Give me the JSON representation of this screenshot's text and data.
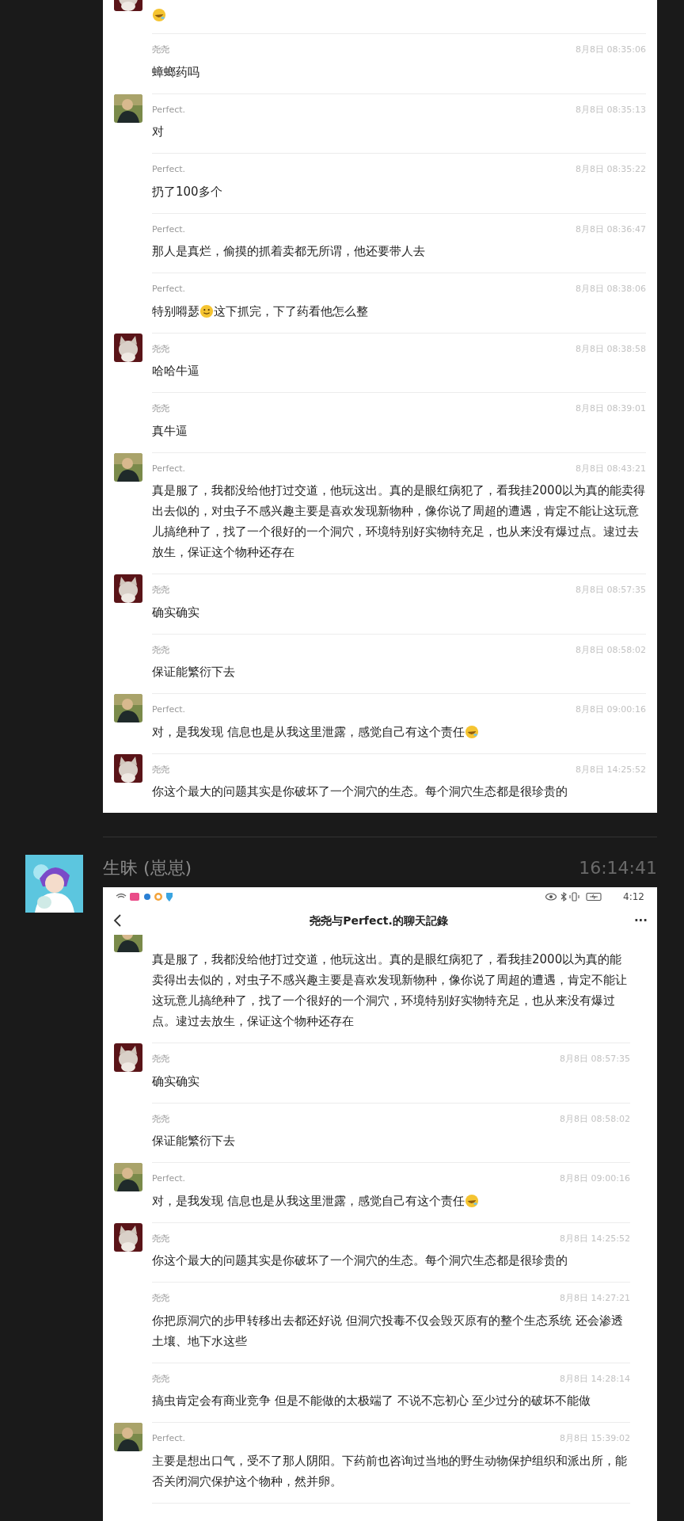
{
  "top_card": {
    "messages": [
      {
        "avatar": {
          "kind": "cat"
        },
        "cut": true,
        "parts": [
          {
            "kind": "laugh_emoji"
          }
        ]
      },
      {
        "name": "尧尧",
        "time": "8月8日 08:35:06",
        "parts": [
          {
            "kind": "text",
            "text": "蟑螂药吗"
          }
        ]
      },
      {
        "avatar": {
          "kind": "person"
        },
        "name": "Perfect.",
        "time": "8月8日 08:35:13",
        "parts": [
          {
            "kind": "text",
            "text": "对"
          }
        ]
      },
      {
        "name": "Perfect.",
        "time": "8月8日 08:35:22",
        "parts": [
          {
            "kind": "text",
            "text": "扔了100多个"
          }
        ]
      },
      {
        "name": "Perfect.",
        "time": "8月8日 08:36:47",
        "parts": [
          {
            "kind": "text",
            "text": "那人是真烂，偷摸的抓着卖都无所谓，他还要带人去"
          }
        ]
      },
      {
        "name": "Perfect.",
        "time": "8月8日 08:38:06",
        "parts": [
          {
            "kind": "text",
            "text": "特别嘚瑟"
          },
          {
            "kind": "smile_emoji"
          },
          {
            "kind": "text",
            "text": "这下抓完，下了药看他怎么整"
          }
        ]
      },
      {
        "avatar": {
          "kind": "cat"
        },
        "name": "尧尧",
        "time": "8月8日 08:38:58",
        "parts": [
          {
            "kind": "text",
            "text": "哈哈牛逼"
          }
        ]
      },
      {
        "name": "尧尧",
        "time": "8月8日 08:39:01",
        "parts": [
          {
            "kind": "text",
            "text": "真牛逼"
          }
        ]
      },
      {
        "avatar": {
          "kind": "person"
        },
        "name": "Perfect.",
        "time": "8月8日 08:43:21",
        "parts": [
          {
            "kind": "text",
            "text": "真是服了，我都没给他打过交道，他玩这出。真的是眼红病犯了，看我挂2000以为真的能卖得出去似的，对虫子不感兴趣主要是喜欢发现新物种，像你说了周超的遭遇，肯定不能让这玩意儿搞绝种了，找了一个很好的一个洞穴，环境特别好实物特充足，也从来没有爆过点。逮过去放生，保证这个物种还存在"
          }
        ]
      },
      {
        "avatar": {
          "kind": "cat"
        },
        "name": "尧尧",
        "time": "8月8日 08:57:35",
        "parts": [
          {
            "kind": "text",
            "text": "确实确实"
          }
        ]
      },
      {
        "name": "尧尧",
        "time": "8月8日 08:58:02",
        "parts": [
          {
            "kind": "text",
            "text": "保证能繁衍下去"
          }
        ]
      },
      {
        "avatar": {
          "kind": "person"
        },
        "name": "Perfect.",
        "time": "8月8日 09:00:16",
        "parts": [
          {
            "kind": "text",
            "text": "对，是我发现 信息也是从我这里泄露，感觉自己有这个责任"
          },
          {
            "kind": "laugh_emoji"
          }
        ]
      },
      {
        "avatar": {
          "kind": "cat"
        },
        "name": "尧尧",
        "time": "8月8日 14:25:52",
        "parts": [
          {
            "kind": "text",
            "text": "你这个最大的问题其实是你破坏了一个洞穴的生态。每个洞穴生态都是很珍贵的"
          }
        ]
      }
    ]
  },
  "post": {
    "sender": "生昧 (崽崽)",
    "time": "16:14:41"
  },
  "screenshot": {
    "status_time": "4:12",
    "title": "尧尧与Perfect.的聊天記錄",
    "more": "···",
    "messages": [
      {
        "avatar": {
          "kind": "person"
        },
        "cut": true,
        "parts": [
          {
            "kind": "text",
            "text": "真是服了，我都没给他打过交道，他玩这出。真的是眼红病犯了，看我挂2000以为真的能卖得出去似的，对虫子不感兴趣主要是喜欢发现新物种，像你说了周超的遭遇，肯定不能让这玩意儿搞绝种了，找了一个很好的一个洞穴，环境特别好实物特充足，也从来没有爆过点。逮过去放生，保证这个物种还存在"
          }
        ]
      },
      {
        "avatar": {
          "kind": "cat"
        },
        "name": "尧尧",
        "time": "8月8日 08:57:35",
        "parts": [
          {
            "kind": "text",
            "text": "确实确实"
          }
        ]
      },
      {
        "name": "尧尧",
        "time": "8月8日 08:58:02",
        "parts": [
          {
            "kind": "text",
            "text": "保证能繁衍下去"
          }
        ]
      },
      {
        "avatar": {
          "kind": "person"
        },
        "name": "Perfect.",
        "time": "8月8日 09:00:16",
        "parts": [
          {
            "kind": "text",
            "text": "对，是我发现 信息也是从我这里泄露，感觉自己有这个责任"
          },
          {
            "kind": "laugh_emoji"
          }
        ]
      },
      {
        "avatar": {
          "kind": "cat"
        },
        "name": "尧尧",
        "time": "8月8日 14:25:52",
        "parts": [
          {
            "kind": "text",
            "text": "你这个最大的问题其实是你破坏了一个洞穴的生态。每个洞穴生态都是很珍贵的"
          }
        ]
      },
      {
        "name": "尧尧",
        "time": "8月8日 14:27:21",
        "parts": [
          {
            "kind": "text",
            "text": "你把原洞穴的步甲转移出去都还好说 但洞穴投毒不仅会毁灭原有的整个生态系统 还会渗透土壤、地下水这些"
          }
        ]
      },
      {
        "name": "尧尧",
        "time": "8月8日 14:28:14",
        "parts": [
          {
            "kind": "text",
            "text": "搞虫肯定会有商业竞争 但是不能做的太极端了 不说不忘初心 至少过分的破坏不能做"
          }
        ]
      },
      {
        "avatar": {
          "kind": "person"
        },
        "name": "Perfect.",
        "time": "8月8日 15:39:02",
        "parts": [
          {
            "kind": "text",
            "text": "主要是想出口气，受不了那人阴阳。下药前也咨询过当地的野生动物保护组织和派出所，能否关闭洞穴保护这个物种，然并卵。"
          }
        ]
      }
    ]
  }
}
